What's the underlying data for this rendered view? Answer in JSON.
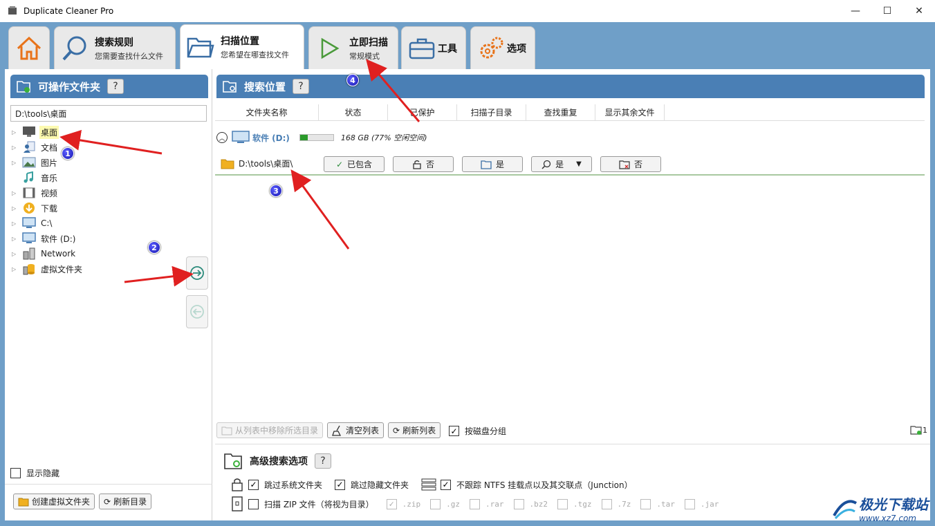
{
  "window": {
    "title": "Duplicate Cleaner Pro"
  },
  "tabs": [
    {
      "name": "",
      "sub": "",
      "icon": "home-icon"
    },
    {
      "name": "搜索规则",
      "sub": "您需要查找什么文件",
      "icon": "search-icon"
    },
    {
      "name": "扫描位置",
      "sub": "您希望在哪查找文件",
      "icon": "folder-icon",
      "active": true
    },
    {
      "name": "立即扫描",
      "sub": "常规模式",
      "icon": "play-icon"
    },
    {
      "name": "工具",
      "sub": "",
      "icon": "toolbox-icon"
    },
    {
      "name": "选项",
      "sub": "",
      "icon": "gears-icon"
    }
  ],
  "left": {
    "header": "可操作文件夹",
    "help": "?",
    "path": "D:\\tools\\桌面",
    "tree": [
      {
        "label": "桌面",
        "icon": "desktop-icon"
      },
      {
        "label": "文档",
        "icon": "documents-icon"
      },
      {
        "label": "图片",
        "icon": "pictures-icon"
      },
      {
        "label": "音乐",
        "icon": "music-icon"
      },
      {
        "label": "视频",
        "icon": "video-icon"
      },
      {
        "label": "下载",
        "icon": "download-icon"
      },
      {
        "label": "C:\\",
        "icon": "drive-icon"
      },
      {
        "label": "软件 (D:)",
        "icon": "drive-icon"
      },
      {
        "label": "Network",
        "icon": "network-icon"
      },
      {
        "label": "虚拟文件夹",
        "icon": "virtual-folder-icon"
      }
    ],
    "show_hidden": "显示隐藏",
    "create_virtual": "创建虚拟文件夹",
    "refresh": "刷新目录"
  },
  "right": {
    "header": "搜索位置",
    "help": "?",
    "columns": [
      "文件夹名称",
      "状态",
      "已保护",
      "扫描子目录",
      "查找重复",
      "显示其余文件"
    ],
    "drive": {
      "name": "软件 (D:)",
      "space": "168 GB (77% 空闲空间)",
      "free_fraction": 0.23
    },
    "folder": {
      "path": "D:\\tools\\桌面\\",
      "status": "已包含",
      "protected": "否",
      "subdirs": "是",
      "find_dup": "是",
      "show_others": "否"
    },
    "remove_btn": "从列表中移除所选目录",
    "clear_btn": "清空列表",
    "refresh_btn": "刷新列表",
    "group_by_disk": "按磁盘分组",
    "folder_count": "1",
    "advanced": "高级搜索选项",
    "opt_skip_system": "跳过系统文件夹",
    "opt_skip_hidden": "跳过隐藏文件夹",
    "opt_ntfs": "不跟踪 NTFS 挂载点以及其交联点（Junction）",
    "opt_zip": "扫描 ZIP 文件（将视为目录）",
    "zip_exts": [
      ".zip",
      ".gz",
      ".rar",
      ".bz2",
      ".tgz",
      ".7z",
      ".tar",
      ".jar"
    ]
  },
  "annotations": {
    "m1": "1",
    "m2": "2",
    "m3": "3",
    "m4": "4"
  },
  "watermark": {
    "title": "极光下载站",
    "site": "www.xz7.com"
  }
}
